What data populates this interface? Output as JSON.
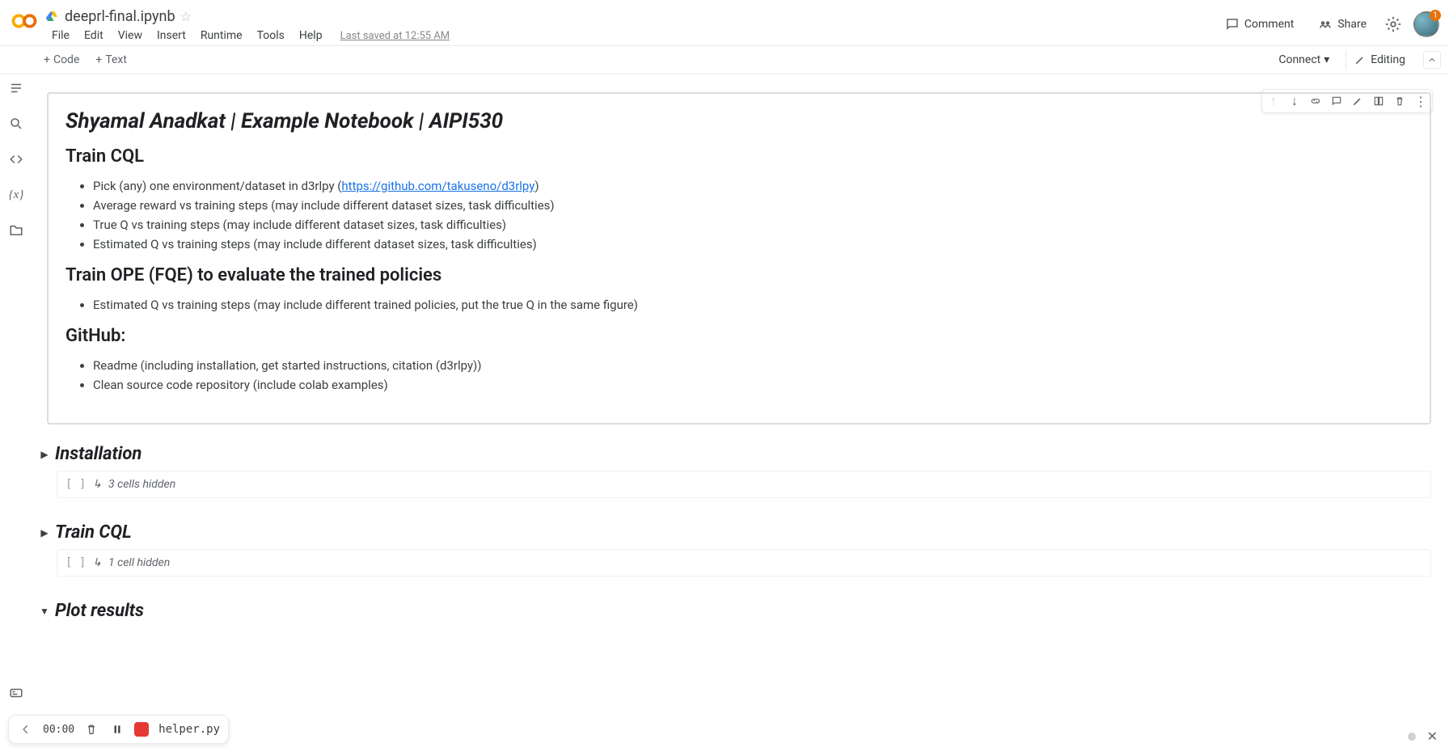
{
  "header": {
    "filename": "deeprl-final.ipynb",
    "menu": [
      "File",
      "Edit",
      "View",
      "Insert",
      "Runtime",
      "Tools",
      "Help"
    ],
    "saved": "Last saved at 12:55 AM",
    "comment": "Comment",
    "share": "Share"
  },
  "toolbar": {
    "code": "Code",
    "text": "Text",
    "connect": "Connect",
    "editing": "Editing"
  },
  "cell0": {
    "title": "Shyamal Anadkat | Example Notebook | AIPI530",
    "h2a": "Train CQL",
    "la1_pre": "Pick (any) one environment/dataset in d3rlpy (",
    "la1_link": "https://github.com/takuseno/d3rlpy",
    "la1_post": ")",
    "la2": "Average reward vs training steps (may include different dataset sizes, task difficulties)",
    "la3": "True Q vs training steps (may include different dataset sizes, task difficulties)",
    "la4": "Estimated Q vs training steps (may include different dataset sizes, task difficulties)",
    "h2b": "Train OPE (FQE) to evaluate the trained policies",
    "lb1": "Estimated Q vs training steps (may include different trained policies, put the true Q in the same figure)",
    "h2c": "GitHub:",
    "lc1": "Readme (including installation, get started instructions, citation (d3rlpy))",
    "lc2": "Clean source code repository (include colab examples)"
  },
  "sections": {
    "s1": {
      "title": "Installation",
      "hidden": "3 cells hidden"
    },
    "s2": {
      "title": "Train CQL",
      "hidden": "1 cell hidden"
    },
    "s3": {
      "title": "Plot results"
    }
  },
  "bottom": {
    "timer": "00:00",
    "file": "helper.py"
  }
}
